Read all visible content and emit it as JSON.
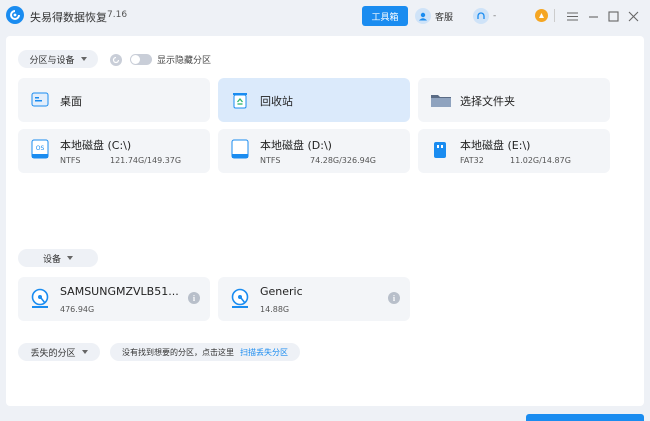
{
  "titlebar": {
    "app_title": "失易得数据恢复",
    "version": "7.16",
    "toolbox_label": "工具箱",
    "support_label": "客服",
    "user_name": "-",
    "colors": {
      "accent": "#1a8cf0",
      "coin": "#f5a623"
    }
  },
  "partitions_section": {
    "dropdown_label": "分区与设备",
    "toggle_label": "显示隐藏分区",
    "locations": [
      {
        "label": "桌面",
        "icon": "desktop-icon"
      },
      {
        "label": "回收站",
        "icon": "recycle-bin-icon"
      },
      {
        "label": "选择文件夹",
        "icon": "folder-icon"
      }
    ],
    "disks": [
      {
        "name": "本地磁盘 (C:\\)",
        "fs": "NTFS",
        "size": "121.74G/149.37G",
        "icon": "os-disk-icon"
      },
      {
        "name": "本地磁盘 (D:\\)",
        "fs": "NTFS",
        "size": "74.28G/326.94G",
        "icon": "disk-icon"
      },
      {
        "name": "本地磁盘 (E:\\)",
        "fs": "FAT32",
        "size": "11.02G/14.87G",
        "icon": "usb-disk-icon"
      }
    ]
  },
  "devices_section": {
    "dropdown_label": "设备",
    "devices": [
      {
        "name": "SAMSUNGMZVLB51...",
        "size": "476.94G"
      },
      {
        "name": "Generic",
        "size": "14.88G"
      }
    ]
  },
  "lost_section": {
    "dropdown_label": "丢失的分区",
    "message": "没有找到想要的分区，点击这里",
    "scan_link": "扫描丢失分区"
  }
}
